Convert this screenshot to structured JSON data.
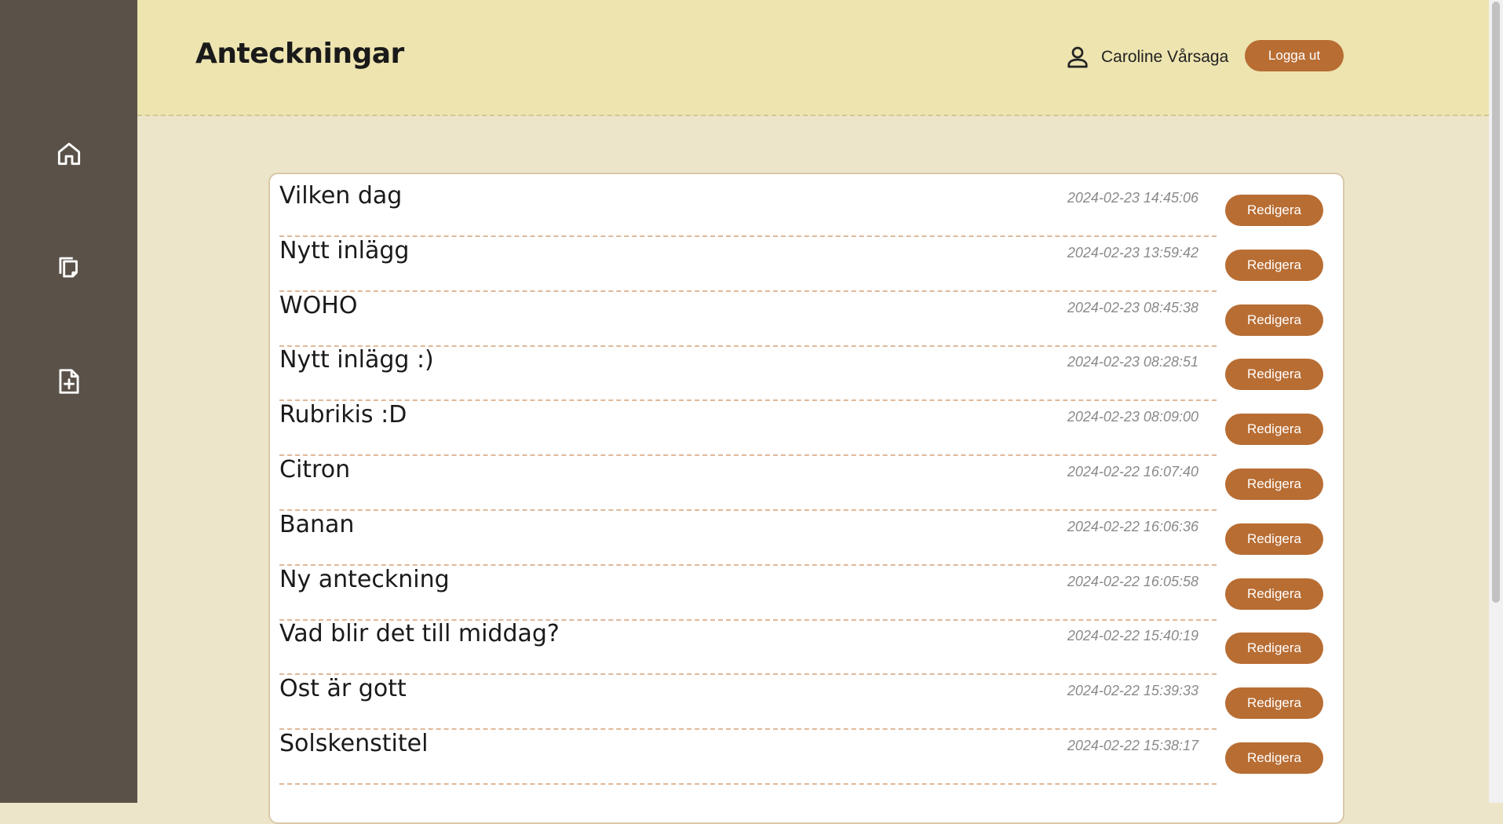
{
  "sidebar": {
    "items": [
      {
        "icon": "home-icon"
      },
      {
        "icon": "notes-icon"
      },
      {
        "icon": "new-note-icon"
      }
    ]
  },
  "header": {
    "title": "Anteckningar",
    "user_icon": "user-icon",
    "user_name": "Caroline Vårsaga",
    "logout_label": "Logga ut"
  },
  "colors": {
    "sidebar": "#5a5249",
    "header": "#ede4b0",
    "background": "#ece5c9",
    "accent": "#b86d33"
  },
  "notes": [
    {
      "title": "Vilken dag",
      "date": "2024-02-23 14:45:06",
      "edit_label": "Redigera"
    },
    {
      "title": "Nytt inlägg",
      "date": "2024-02-23 13:59:42",
      "edit_label": "Redigera"
    },
    {
      "title": "WOHO",
      "date": "2024-02-23 08:45:38",
      "edit_label": "Redigera"
    },
    {
      "title": "Nytt inlägg :)",
      "date": "2024-02-23 08:28:51",
      "edit_label": "Redigera"
    },
    {
      "title": "Rubrikis :D",
      "date": "2024-02-23 08:09:00",
      "edit_label": "Redigera"
    },
    {
      "title": "Citron",
      "date": "2024-02-22 16:07:40",
      "edit_label": "Redigera"
    },
    {
      "title": "Banan",
      "date": "2024-02-22 16:06:36",
      "edit_label": "Redigera"
    },
    {
      "title": "Ny anteckning",
      "date": "2024-02-22 16:05:58",
      "edit_label": "Redigera"
    },
    {
      "title": "Vad blir det till middag?",
      "date": "2024-02-22 15:40:19",
      "edit_label": "Redigera"
    },
    {
      "title": "Ost är gott",
      "date": "2024-02-22 15:39:33",
      "edit_label": "Redigera"
    },
    {
      "title": "Solskenstitel",
      "date": "2024-02-22 15:38:17",
      "edit_label": "Redigera"
    }
  ]
}
